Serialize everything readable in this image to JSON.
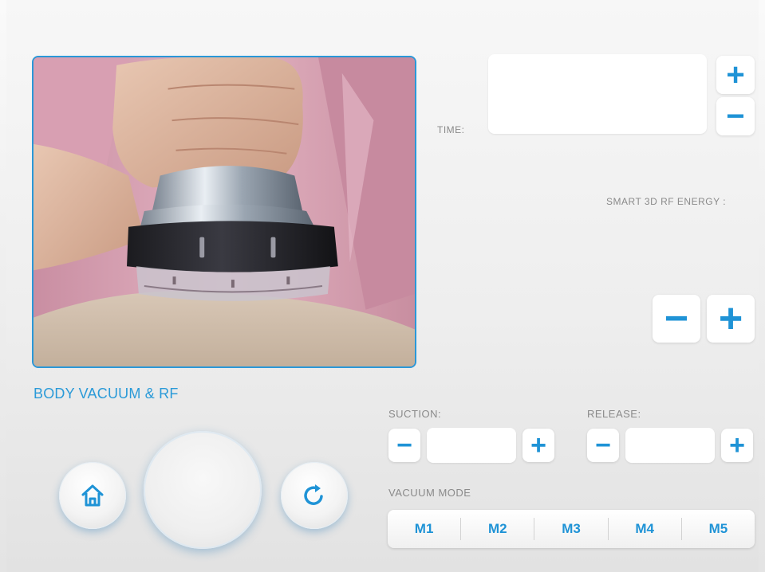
{
  "treatment": {
    "title": "BODY VACUUM & RF"
  },
  "time": {
    "label": "TIME:",
    "value": ""
  },
  "energy": {
    "label": "SMART 3D RF ENERGY :"
  },
  "suction": {
    "label": "SUCTION:",
    "value": ""
  },
  "release": {
    "label": "RELEASE:",
    "value": ""
  },
  "vacuum_mode": {
    "label": "VACUUM MODE",
    "modes": [
      "M1",
      "M2",
      "M3",
      "M4",
      "M5"
    ]
  },
  "symbols": {
    "plus": "+",
    "minus": "−"
  },
  "icons": {
    "home": "home-icon",
    "refresh": "refresh-icon"
  },
  "colors": {
    "accent": "#1f93d6",
    "photo_border": "#2a98d8",
    "label": "#8a8a8a"
  }
}
